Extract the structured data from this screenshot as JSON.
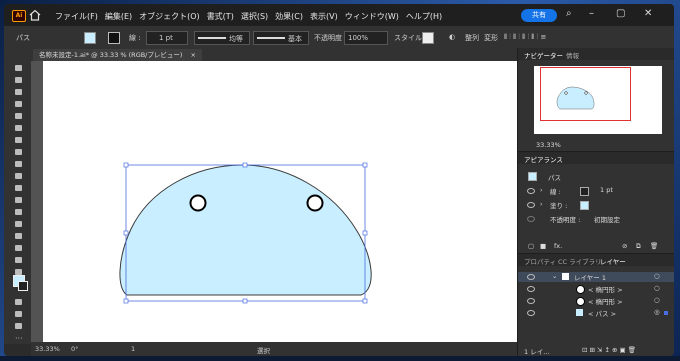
{
  "app": {
    "logo": "Ai"
  },
  "menu": [
    "ファイル(F)",
    "編集(E)",
    "オブジェクト(O)",
    "書式(T)",
    "選択(S)",
    "効果(C)",
    "表示(V)",
    "ウィンドウ(W)",
    "ヘルプ(H)"
  ],
  "share_label": "共有",
  "control": {
    "object_type": "パス",
    "stroke_label": "線 :",
    "stroke_value": "1 pt",
    "uniform_label": "均等",
    "basic_label": "基本",
    "opacity_label": "不透明度 :",
    "opacity_value": "100%",
    "style_label": "スタイル :",
    "align_label": "整列",
    "transform_label": "変形"
  },
  "document_tab": "名称未設定-1.ai* @ 33.33 % (RGB/プレビュー)",
  "status": {
    "zoom": "33.33%",
    "rotation": "0°",
    "artboard": "1",
    "mode": "選択"
  },
  "navigator": {
    "tabs": [
      "ナビゲーター",
      "情報"
    ],
    "zoom": "33.33%"
  },
  "appearance": {
    "title": "アピアランス",
    "object": "パス",
    "stroke_label": "線 :",
    "stroke_value": "1 pt",
    "fill_label": "塗り :",
    "opacity_label": "不透明度 :",
    "opacity_value": "初期設定",
    "fx": "fx."
  },
  "layers": {
    "tabs": [
      "プロパティ",
      "CC ライブラリ",
      "レイヤー"
    ],
    "items": [
      {
        "label": "レイヤー 1"
      },
      {
        "label": "< 楕円形 >"
      },
      {
        "label": "< 楕円形 >"
      },
      {
        "label": "< パス >"
      }
    ],
    "footer": "1 レイ..."
  },
  "colors": {
    "fill": "#c8eeff",
    "stroke": "#3a3a3a",
    "selection": "#4a6ee0",
    "accent": "#1473e6"
  }
}
